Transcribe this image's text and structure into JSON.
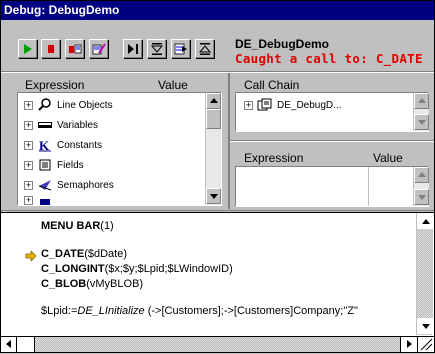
{
  "window": {
    "title": "Debug: DebugDemo"
  },
  "toolbar": {
    "buttons": [
      "no-trace",
      "abort",
      "abort-and-edit",
      "edit",
      "step-over",
      "step-into",
      "step-out",
      "trace-into"
    ]
  },
  "header": {
    "process_name": "DE_DebugDemo",
    "status": "Caught a call to: C_DATE"
  },
  "expression_pane": {
    "col_expression": "Expression",
    "col_value": "Value",
    "items": [
      {
        "label": "Line Objects",
        "icon": "magnifier-icon"
      },
      {
        "label": "Variables",
        "icon": "variables-icon"
      },
      {
        "label": "Constants",
        "icon": "constants-k-icon"
      },
      {
        "label": "Fields",
        "icon": "fields-icon"
      },
      {
        "label": "Semaphores",
        "icon": "semaphore-flag-icon"
      }
    ]
  },
  "call_chain_pane": {
    "header": "Call Chain",
    "items": [
      {
        "label": "DE_DebugD..."
      }
    ]
  },
  "custom_watch_pane": {
    "col_expression": "Expression",
    "col_value": "Value"
  },
  "source_pane": {
    "lines": [
      {
        "parts": [
          {
            "t": "MENU BAR",
            "s": "b"
          },
          {
            "t": "(1)",
            "s": "n"
          }
        ],
        "current": false
      },
      {
        "parts": [],
        "current": false
      },
      {
        "parts": [
          {
            "t": "C_DATE",
            "s": "b"
          },
          {
            "t": "($dDate)",
            "s": "n"
          }
        ],
        "current": true
      },
      {
        "parts": [
          {
            "t": "C_LONGINT",
            "s": "b"
          },
          {
            "t": "($x;$y;$Lpid;$LWindowID)",
            "s": "n"
          }
        ],
        "current": false
      },
      {
        "parts": [
          {
            "t": "C_BLOB",
            "s": "b"
          },
          {
            "t": "(vMyBLOB)",
            "s": "n"
          }
        ],
        "current": false
      },
      {
        "parts": [],
        "current": false
      },
      {
        "parts": [
          {
            "t": "$Lpid:=",
            "s": "n"
          },
          {
            "t": "DE_LInitialize",
            "s": "i"
          },
          {
            "t": " (->[Customers];->[Customers]Company;\"Z\"",
            "s": "n"
          }
        ],
        "current": false
      }
    ]
  },
  "colors": {
    "title_bar": "#000080",
    "status_text": "#e00000",
    "arrow": "#e8b800"
  }
}
